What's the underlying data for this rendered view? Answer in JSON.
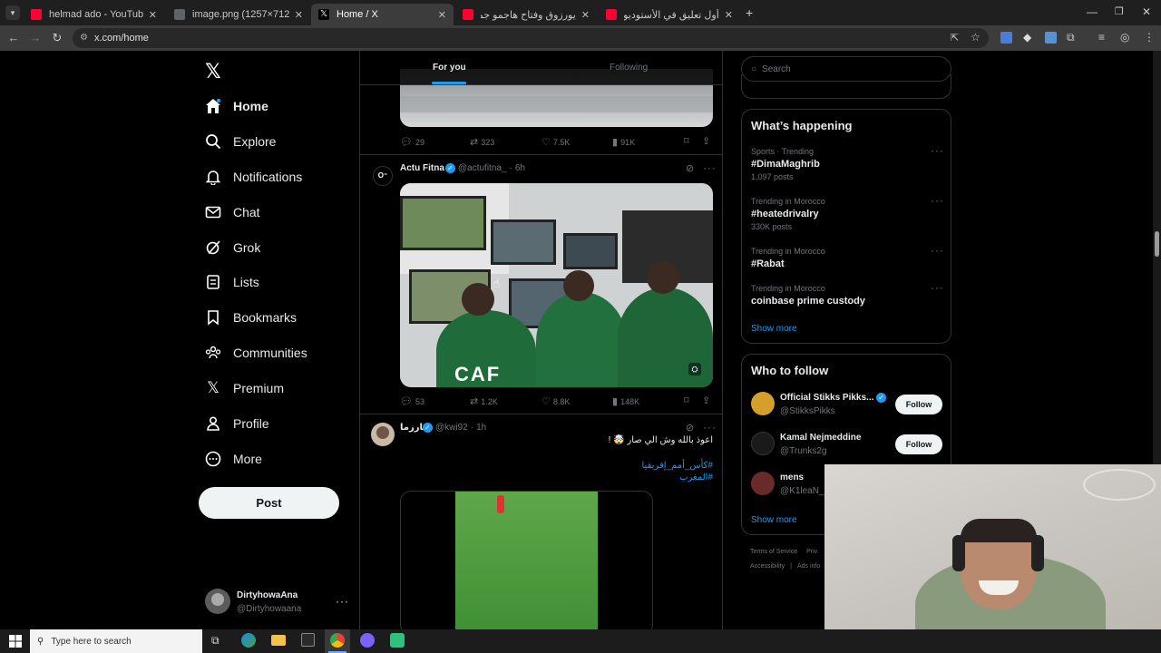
{
  "browser": {
    "tabs": [
      {
        "title": "helmad ado - YouTube",
        "color": "#ff0033"
      },
      {
        "title": "image.png (1257×712)",
        "color": "#5f6368"
      },
      {
        "title": "Home / X",
        "color": "#ffffff"
      },
      {
        "title": "يورزوق وفتاح هاجمو جمهور وريحنا",
        "color": "#ff0033"
      },
      {
        "title": "أول تعليق في الأستوديو بعد تعاد",
        "color": "#ff0033"
      }
    ],
    "new_tab_icon": "plus-icon",
    "url": "x.com/home"
  },
  "sidebar": {
    "items": [
      {
        "label": "Home",
        "icon": "home-icon"
      },
      {
        "label": "Explore",
        "icon": "search-icon"
      },
      {
        "label": "Notifications",
        "icon": "bell-icon"
      },
      {
        "label": "Chat",
        "icon": "mail-icon"
      },
      {
        "label": "Grok",
        "icon": "grok-icon"
      },
      {
        "label": "Lists",
        "icon": "list-icon"
      },
      {
        "label": "Bookmarks",
        "icon": "bookmark-icon"
      },
      {
        "label": "Communities",
        "icon": "people-icon"
      },
      {
        "label": "Premium",
        "icon": "x-icon"
      },
      {
        "label": "Profile",
        "icon": "person-icon"
      },
      {
        "label": "More",
        "icon": "more-circle-icon"
      }
    ],
    "post_label": "Post",
    "account": {
      "name": "DirtyhowaAna",
      "handle": "@Dirtyhowaana"
    }
  },
  "feed": {
    "tabs": [
      {
        "label": "For you"
      },
      {
        "label": "Following"
      }
    ],
    "prev_post_stats": {
      "replies": "29",
      "reposts": "323",
      "likes": "7.5K",
      "views": "91K"
    },
    "posts": [
      {
        "name": "Actu Fitna",
        "handle": "@actufitna_",
        "time": "6h",
        "image_caption": "CAF",
        "stats": {
          "replies": "53",
          "reposts": "1.2K",
          "likes": "8.8K",
          "views": "148K"
        }
      },
      {
        "name": "كارزما",
        "handle": "@kwi92",
        "time": "1h",
        "text": "اعوذ بالله وش الي صار 🤯 !",
        "hashtags": [
          "#كأس_أمم_إفريقيا",
          "#المغرب"
        ]
      }
    ]
  },
  "right": {
    "search_placeholder": "Search",
    "whats_happening": {
      "title": "What’s happening",
      "trends": [
        {
          "meta": "Sports · Trending",
          "name": "#DimaMaghrib",
          "posts": "1,097 posts"
        },
        {
          "meta": "Trending in Morocco",
          "name": "#heatedrivalry",
          "posts": "330K posts"
        },
        {
          "meta": "Trending in Morocco",
          "name": "#Rabat",
          "posts": ""
        },
        {
          "meta": "Trending in Morocco",
          "name": "coinbase prime custody",
          "posts": ""
        }
      ],
      "show_more": "Show more"
    },
    "who_to_follow": {
      "title": "Who to follow",
      "users": [
        {
          "name": "Official Stikks Pikks...",
          "handle": "@StikksPikks",
          "follow": "Follow"
        },
        {
          "name": "Kamal Nejmeddine",
          "handle": "@Trunks2g",
          "follow": "Follow"
        },
        {
          "name": "mens",
          "handle": "@K1leaN_",
          "follow": ""
        }
      ],
      "show_more": "Show more"
    },
    "footer": {
      "terms": "Terms of Service",
      "privacy": "Priv",
      "accessibility": "Accessibility",
      "ads": "Ads info"
    }
  },
  "taskbar": {
    "search_placeholder": "Type here to search"
  }
}
